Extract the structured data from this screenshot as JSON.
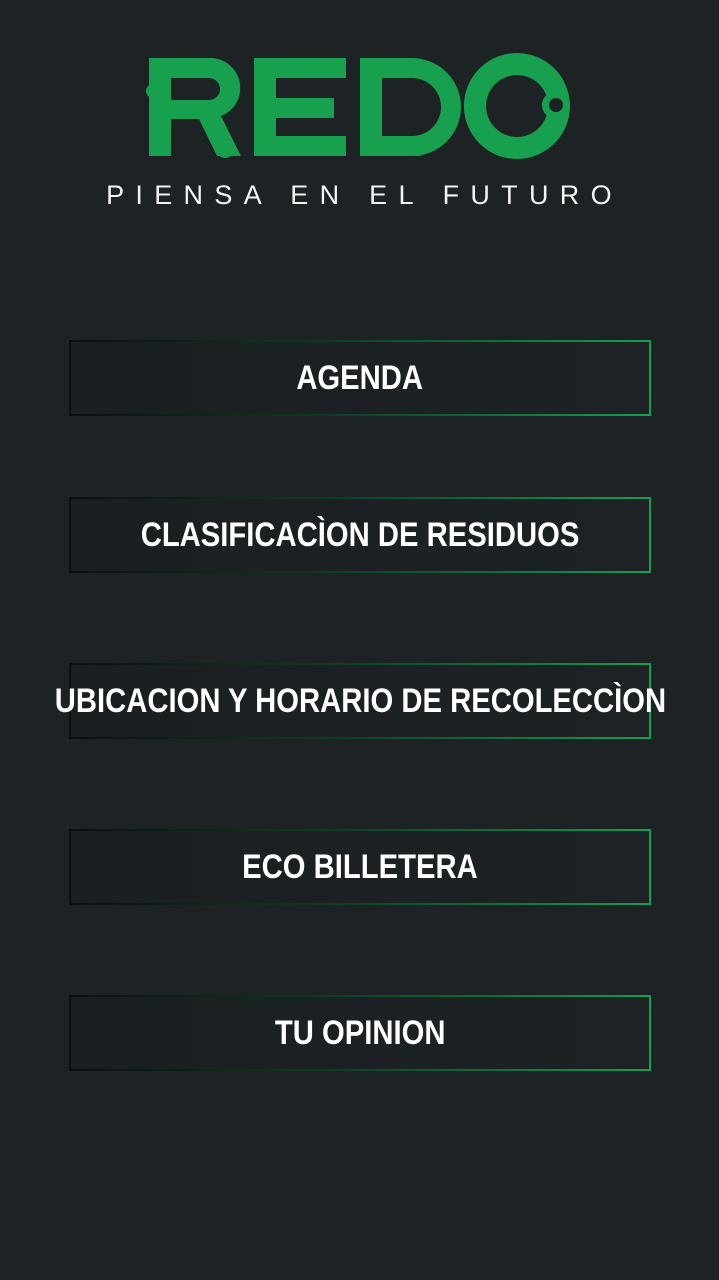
{
  "header": {
    "logo_text": "REDO",
    "tagline": "PIENSA EN EL FUTURO",
    "brand_color": "#17a04e"
  },
  "menu": {
    "items": [
      {
        "label": "AGENDA"
      },
      {
        "label": "CLASIFICACÌON DE RESIDUOS"
      },
      {
        "label": "UBICACION Y HORARIO DE RECOLECCÌON"
      },
      {
        "label": "ECO BILLETERA"
      },
      {
        "label": "TU OPINION"
      }
    ]
  },
  "colors": {
    "background": "#1d2225",
    "accent": "#17a04e",
    "text": "#ffffff"
  }
}
